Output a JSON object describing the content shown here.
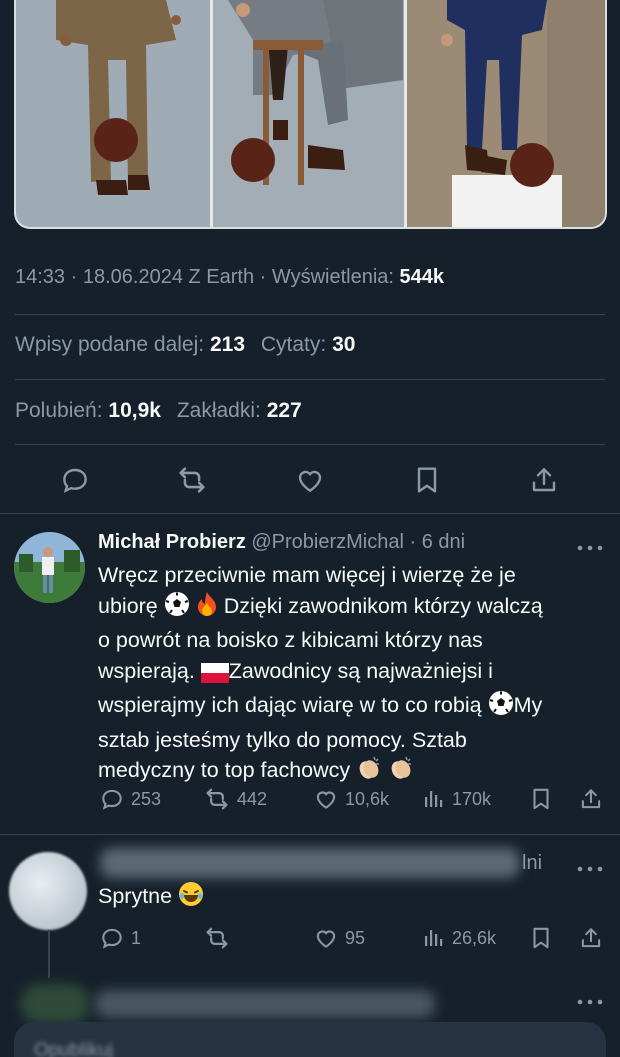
{
  "post": {
    "time": "14:33",
    "date": "18.06.2024",
    "source": "Z Earth",
    "views_label": "Wyświetlenia:",
    "views": "544k",
    "reposts_label": "Wpisy podane dalej:",
    "reposts": "213",
    "quotes_label": "Cytaty:",
    "quotes": "30",
    "likes_label": "Polubień:",
    "likes": "10,9k",
    "bookmarks_label": "Zakładki:",
    "bookmarks": "227"
  },
  "actions": [
    "reply-icon",
    "repost-icon",
    "like-icon",
    "bookmark-icon",
    "share-icon"
  ],
  "replies": [
    {
      "name": "Michał Probierz",
      "handle": "@ProbierzMichal",
      "age": "6 dni",
      "lines": [
        "Wręcz przeciwnie mam więcej i wierzę że je",
        "ubiorę",
        "Dzięki zawodnikom którzy walczą",
        "o powrót na boisko z kibicami którzy nas",
        "wspierają.",
        "Zawodnicy są najważniejsi i",
        "wspierajmy ich dając wiarę w to co robią",
        "My",
        "sztab jesteśmy tylko do pomocy. Sztab",
        "medyczny to top fachowcy"
      ],
      "stats": {
        "replies": "253",
        "reposts": "442",
        "likes": "10,6k",
        "views": "170k"
      }
    },
    {
      "age_fragment": "lni",
      "text": "Sprytne",
      "stats": {
        "replies": "1",
        "reposts": "",
        "likes": "95",
        "views": "26,6k"
      }
    }
  ],
  "bottom_fragment": "Opublikuj"
}
